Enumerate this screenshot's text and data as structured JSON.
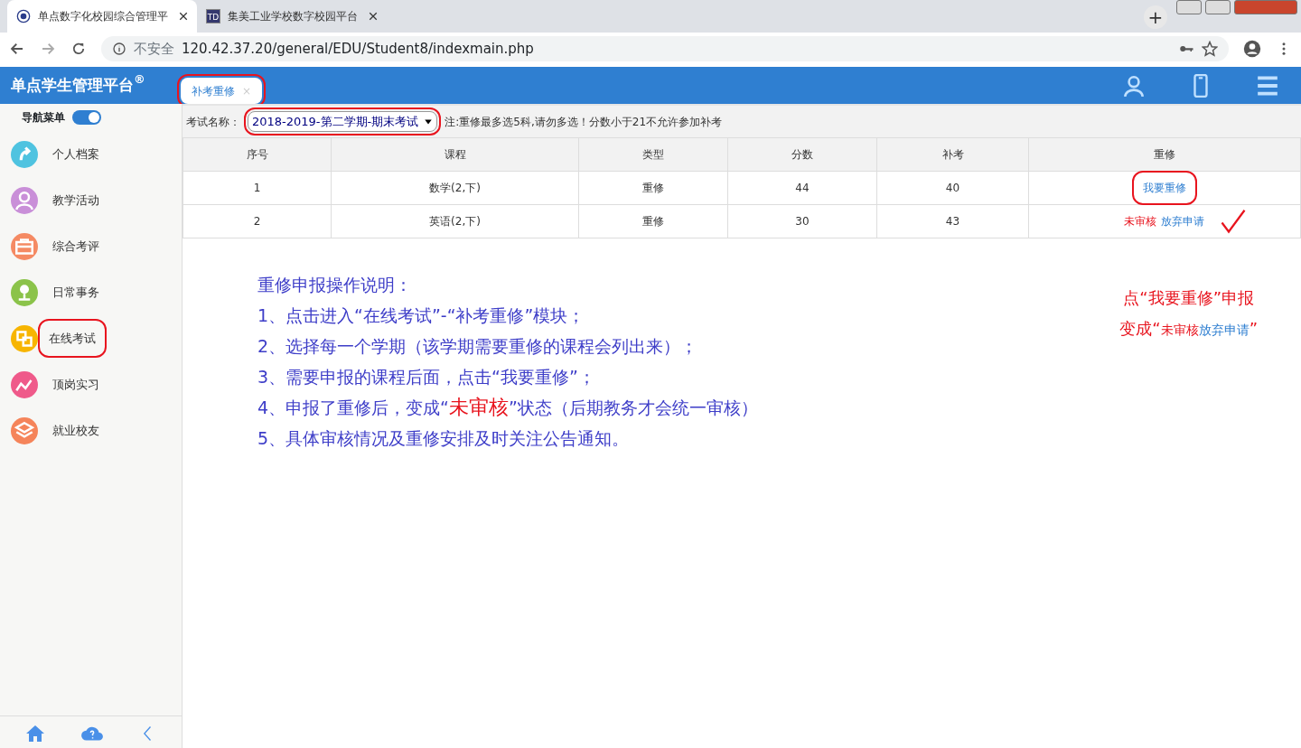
{
  "browser": {
    "tabs": [
      {
        "title": "单点数字化校园综合管理平",
        "selected": true
      },
      {
        "title": "集美工业学校数字校园平台",
        "selected": false
      }
    ],
    "icon_text": "TD",
    "new_tab": "+",
    "security": "不安全",
    "url": "120.42.37.20/general/EDU/Student8/indexmain.php"
  },
  "app": {
    "title": "单点学生管理平台$^{®}$"
  },
  "page_tabs": [
    {
      "label": "补考重修",
      "selected": true,
      "circled": true,
      "close": "×"
    }
  ],
  "nav_toggle": {
    "label": "导航菜单",
    "on": true
  },
  "sidebar": {
    "items": [
      {
        "label": "个人档案",
        "color": "#4fc3e0",
        "circled": false
      },
      {
        "label": "教学活动",
        "color": "#c98fd8",
        "circled": false
      },
      {
        "label": "综合考评",
        "color": "#f58a63",
        "circled": false
      },
      {
        "label": "日常事务",
        "color": "#8bc34a",
        "circled": false
      },
      {
        "label": "在线考试",
        "color": "#f7b500",
        "circled": true
      },
      {
        "label": "顶岗实习",
        "color": "#ef5a8a",
        "circled": false
      },
      {
        "label": "就业校友",
        "color": "#f5845a",
        "circled": false
      }
    ]
  },
  "filter": {
    "label": "考试名称：",
    "value": "2018-2019-第二学期-期末考试",
    "circled": true,
    "note": "注:重修最多选5科,请勿多选！分数小于21不允许参加补考"
  },
  "table": {
    "columns": [
      "序号",
      "课程",
      "类型",
      "分数",
      "补考",
      "重修"
    ],
    "rows": [
      {
        "cells": [
          "1",
          "数学(2,下)",
          "重修",
          "44",
          "40"
        ],
        "actions": [
          {
            "kind": "link",
            "text": "我要重修",
            "circled": true
          }
        ],
        "checked": false
      },
      {
        "cells": [
          "2",
          "英语(2,下)",
          "重修",
          "30",
          "43"
        ],
        "actions": [
          {
            "kind": "status",
            "text": "未审核",
            "circled": false
          },
          {
            "kind": "link",
            "text": "放弃申请",
            "circled": false
          }
        ],
        "checked": true
      }
    ]
  },
  "instructions": {
    "title": "重修申报操作说明：",
    "lines": [
      [
        {
          "kind": "text",
          "text": "1、点击进入“在线考试”-“补考重修”模块；"
        }
      ],
      [
        {
          "kind": "text",
          "text": "2、选择每一个学期（该学期需要重修的课程会列出来）；"
        }
      ],
      [
        {
          "kind": "text",
          "text": "3、需要申报的课程后面，点击“我要重修”；"
        }
      ],
      [
        {
          "kind": "text",
          "text": "4、申报了重修后，变成“"
        },
        {
          "kind": "status",
          "text": "未审核"
        },
        {
          "kind": "text",
          "text": "”状态（后期教务才会统一审核）"
        }
      ],
      [
        {
          "kind": "text",
          "text": "5、具体审核情况及重修安排及时关注公告通知。"
        }
      ]
    ]
  },
  "annotation": {
    "lines": [
      [
        {
          "kind": "text",
          "text": "点“我要重修”申报"
        }
      ],
      [
        {
          "kind": "text",
          "text": "变成“"
        },
        {
          "kind": "status",
          "text": "未审核"
        },
        {
          "kind": "link",
          "text": "放弃申请"
        },
        {
          "kind": "text",
          "text": "”"
        }
      ]
    ]
  }
}
